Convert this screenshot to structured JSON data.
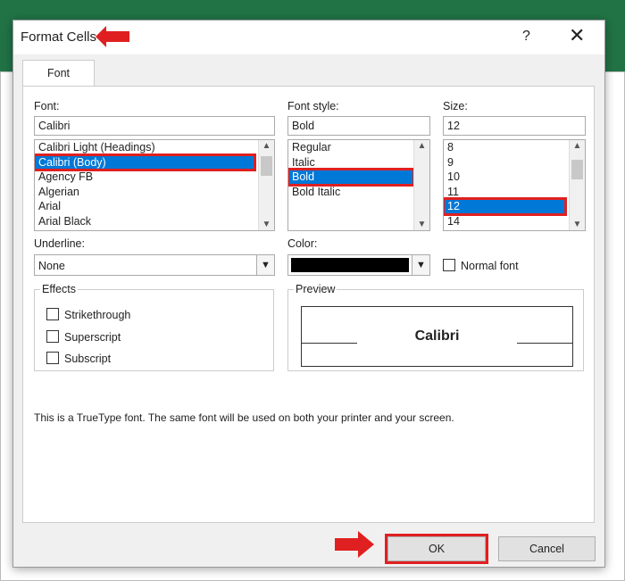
{
  "dialog": {
    "title": "Format Cells",
    "help": "?",
    "close": "✕",
    "tab": "Font"
  },
  "font": {
    "label": "Font:",
    "value": "Calibri",
    "items": [
      "Calibri Light (Headings)",
      "Calibri (Body)",
      "Agency FB",
      "Algerian",
      "Arial",
      "Arial Black"
    ],
    "selected": 1
  },
  "style": {
    "label": "Font style:",
    "value": "Bold",
    "items": [
      "Regular",
      "Italic",
      "Bold",
      "Bold Italic"
    ],
    "selected": 2
  },
  "size": {
    "label": "Size:",
    "value": "12",
    "items": [
      "8",
      "9",
      "10",
      "11",
      "12",
      "14"
    ],
    "selected": 4
  },
  "underline": {
    "label": "Underline:",
    "value": "None"
  },
  "color": {
    "label": "Color:",
    "swatch": "#000000"
  },
  "normal_font": "Normal font",
  "effects": {
    "title": "Effects",
    "items": [
      "Strikethrough",
      "Superscript",
      "Subscript"
    ]
  },
  "preview": {
    "title": "Preview",
    "text": "Calibri"
  },
  "message": "This is a TrueType font.  The same font will be used on both your printer and your screen.",
  "buttons": {
    "ok": "OK",
    "cancel": "Cancel"
  },
  "colors": {
    "accent": "#0078d7",
    "highlight": "#e02020",
    "excel_green": "#217346"
  }
}
